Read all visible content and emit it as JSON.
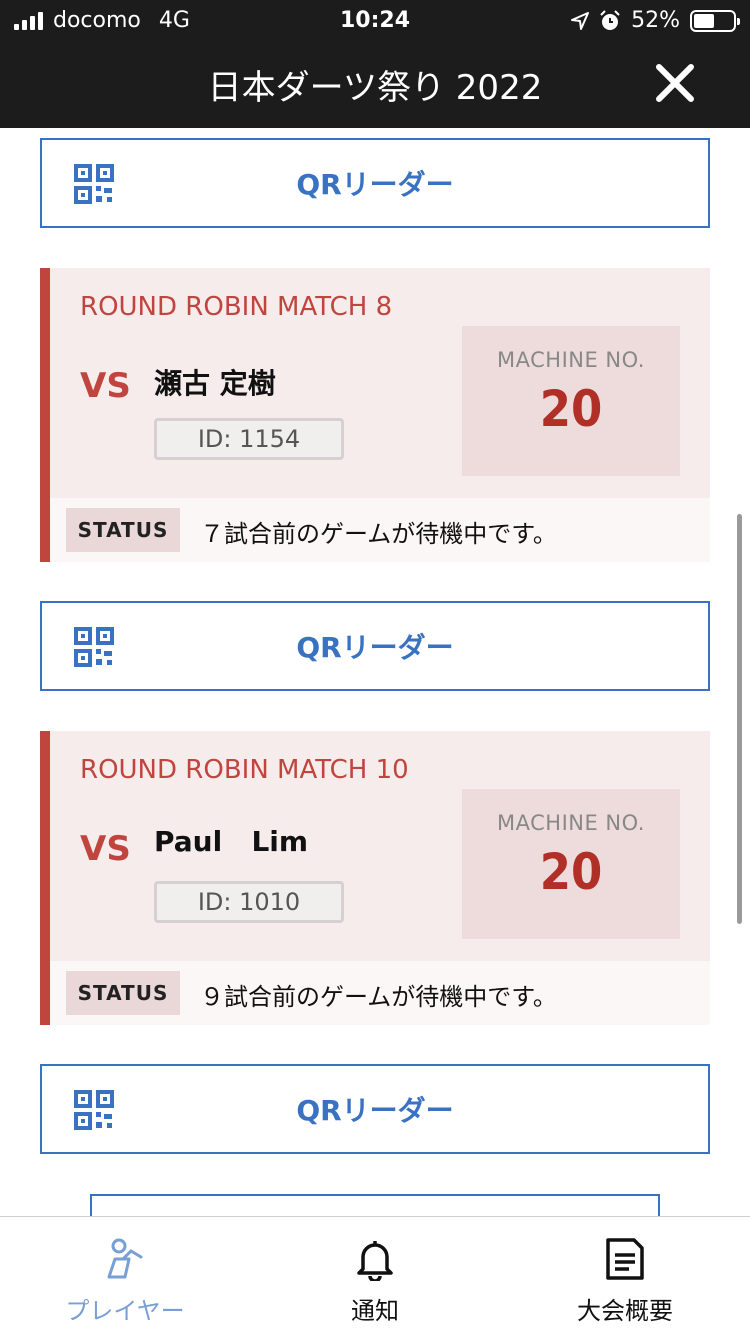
{
  "status_bar": {
    "carrier": "docomo",
    "network": "4G",
    "time": "10:24",
    "battery": "52%",
    "battery_level": 0.52
  },
  "header": {
    "title": "日本ダーツ祭り 2022"
  },
  "qr_button_label": "QRリーダー",
  "matches": [
    {
      "round": "ROUND ROBIN MATCH 8",
      "vs": "VS",
      "player": "瀬古 定樹",
      "id": "ID: 1154",
      "machine_label": "MACHINE NO.",
      "machine_no": "20",
      "status_tag": "STATUS",
      "status_text": "７試合前のゲームが待機中です。"
    },
    {
      "round": "ROUND ROBIN MATCH 10",
      "vs": "VS",
      "player": "Paul   Lim",
      "id": "ID: 1010",
      "machine_label": "MACHINE NO.",
      "machine_no": "20",
      "status_tag": "STATUS",
      "status_text": "９試合前のゲームが待機中です。"
    }
  ],
  "bottom_nav": [
    {
      "label": "プレイヤー",
      "icon": "player-icon",
      "active": true
    },
    {
      "label": "通知",
      "icon": "bell-icon",
      "active": false
    },
    {
      "label": "大会概要",
      "icon": "document-icon",
      "active": false
    }
  ],
  "colors": {
    "accent_blue": "#3a72c2",
    "accent_red": "#c0453e",
    "header_bg": "#1c1c1c"
  }
}
